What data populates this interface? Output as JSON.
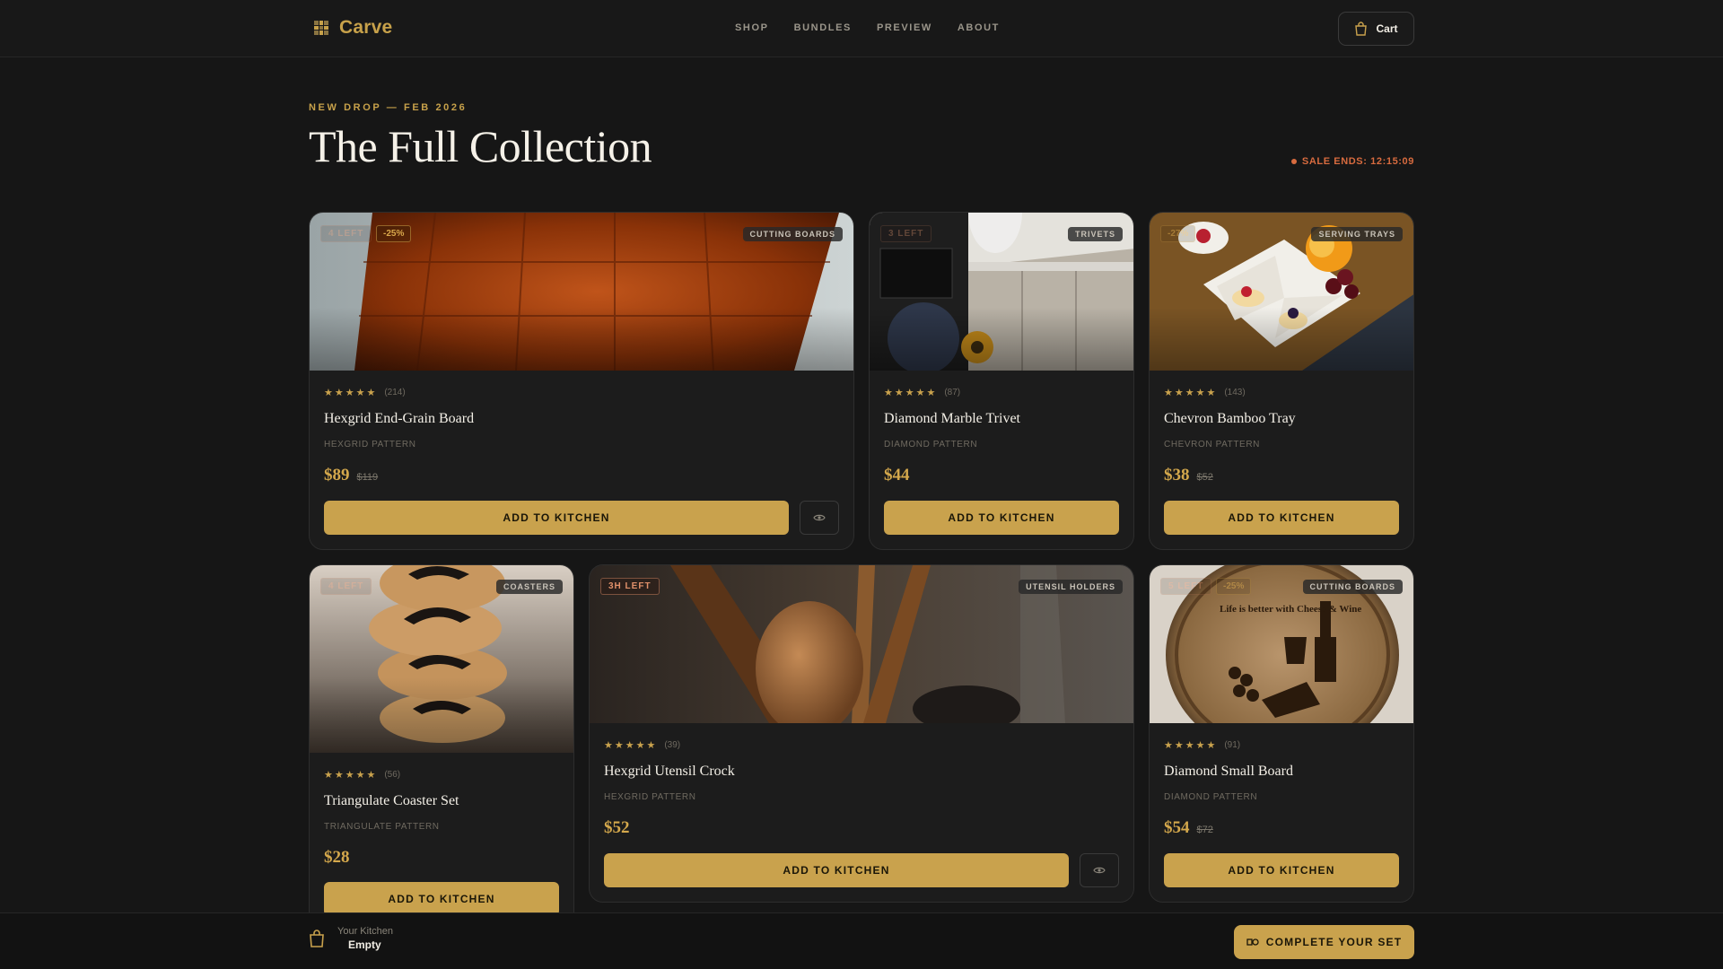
{
  "brand": {
    "name": "Carve"
  },
  "nav": {
    "links": [
      "SHOP",
      "BUNDLES",
      "PREVIEW",
      "ABOUT"
    ],
    "cart_label": "Cart"
  },
  "hero": {
    "eyebrow": "NEW DROP — FEB 2026",
    "title": "The Full Collection",
    "sale_ends": "SALE ENDS: 12:15:09"
  },
  "products": [
    {
      "name": "Hexgrid End-Grain Board",
      "pattern": "HEXGRID PATTERN",
      "category": "CUTTING BOARDS",
      "stock_badge": "4 LEFT",
      "discount": "-25%",
      "stars": "★★★★★",
      "reviews": "(214)",
      "price": "$89",
      "old_price": "$119",
      "cta": "ADD TO KITCHEN"
    },
    {
      "name": "Diamond Marble Trivet",
      "pattern": "DIAMOND PATTERN",
      "category": "TRIVETS",
      "stock_badge": "3 LEFT",
      "stars": "★★★★★",
      "reviews": "(87)",
      "price": "$44",
      "cta": "ADD TO KITCHEN"
    },
    {
      "name": "Chevron Bamboo Tray",
      "pattern": "CHEVRON PATTERN",
      "category": "SERVING TRAYS",
      "discount": "-27%",
      "stars": "★★★★★",
      "reviews": "(143)",
      "price": "$38",
      "old_price": "$52",
      "cta": "ADD TO KITCHEN"
    },
    {
      "name": "Triangulate Coaster Set",
      "pattern": "TRIANGULATE PATTERN",
      "category": "COASTERS",
      "stock_badge": "4 LEFT",
      "stars": "★★★★★",
      "reviews": "(56)",
      "price": "$28",
      "cta": "ADD TO KITCHEN"
    },
    {
      "name": "Hexgrid Utensil Crock",
      "pattern": "HEXGRID PATTERN",
      "category": "UTENSIL HOLDERS",
      "stock_badge": "3H LEFT",
      "stars": "★★★★★",
      "reviews": "(39)",
      "price": "$52",
      "cta": "ADD TO KITCHEN"
    },
    {
      "name": "Diamond Small Board",
      "pattern": "DIAMOND PATTERN",
      "category": "CUTTING BOARDS",
      "stock_badge": "5 LEFT",
      "discount": "-25%",
      "stars": "★★★★★",
      "reviews": "(91)",
      "price": "$54",
      "old_price": "$72",
      "cta": "ADD TO KITCHEN"
    }
  ],
  "image_text": {
    "board_engraving": "Life is better with Cheese & Wine"
  },
  "bottom_bar": {
    "kitchen_label": "Your Kitchen",
    "kitchen_status": "Empty",
    "cta": "COMPLETE YOUR SET"
  },
  "colors": {
    "accent": "#c9a24d",
    "background": "#161616",
    "card": "#1c1c1c",
    "alert": "#d86b3f"
  },
  "icons": [
    "grid-logo-icon",
    "shopping-bag-icon",
    "eye-icon",
    "bundle-icon"
  ]
}
